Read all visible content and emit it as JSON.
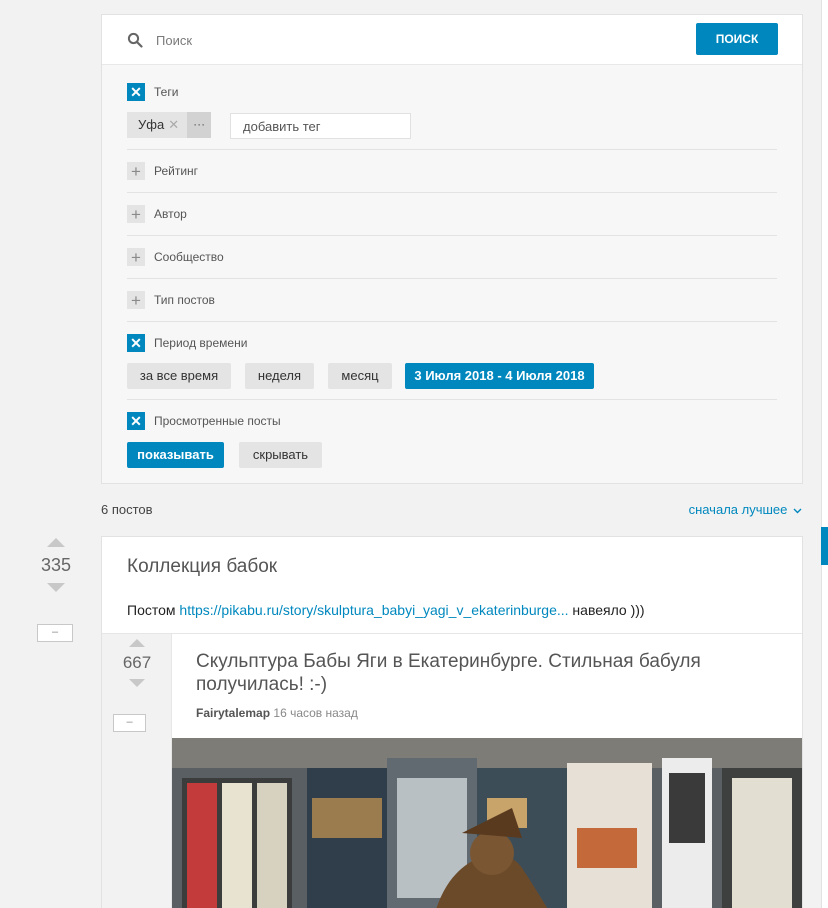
{
  "search": {
    "placeholder": "Поиск",
    "button_label": "ПОИСК"
  },
  "filters": {
    "tags": {
      "label": "Теги",
      "checked": true,
      "items": [
        {
          "name": "Уфа"
        }
      ],
      "more": "···",
      "input_placeholder": "добавить тег"
    },
    "rating": {
      "label": "Рейтинг",
      "checked": false
    },
    "author": {
      "label": "Автор",
      "checked": false
    },
    "community": {
      "label": "Сообщество",
      "checked": false
    },
    "post_type": {
      "label": "Тип постов",
      "checked": false
    },
    "period": {
      "label": "Период времени",
      "checked": true,
      "options": [
        "за все время",
        "неделя",
        "месяц",
        "3 Июля 2018 - 4 Июля 2018"
      ],
      "selected": "3 Июля 2018 - 4 Июля 2018"
    },
    "viewed": {
      "label": "Просмотренные посты",
      "checked": true,
      "options": [
        "показывать",
        "скрывать"
      ],
      "selected": "показывать"
    }
  },
  "results": {
    "count_label": "6 постов",
    "sort_label": "сначала лучшее"
  },
  "post": {
    "rating": "335",
    "minus_label": "–",
    "title": "Коллекция бабок",
    "text_prefix": "Постом",
    "link": "https://pikabu.ru/story/skulptura_babyi_yagi_v_ekaterinburge...",
    "text_suffix": "навеяло )))"
  },
  "inner_post": {
    "rating": "667",
    "minus_label": "–",
    "title": "Скульптура Бабы Яги в Екатеринбурге. Стильная бабуля получилась! :-)",
    "author": "Fairytalemap",
    "time": "16 часов назад"
  },
  "icons": {
    "search": "search-icon",
    "check": "✕",
    "plus": "+",
    "chevron": "chevron-down-icon"
  },
  "colors": {
    "accent": "#0088be",
    "background": "#f2f2f2"
  }
}
